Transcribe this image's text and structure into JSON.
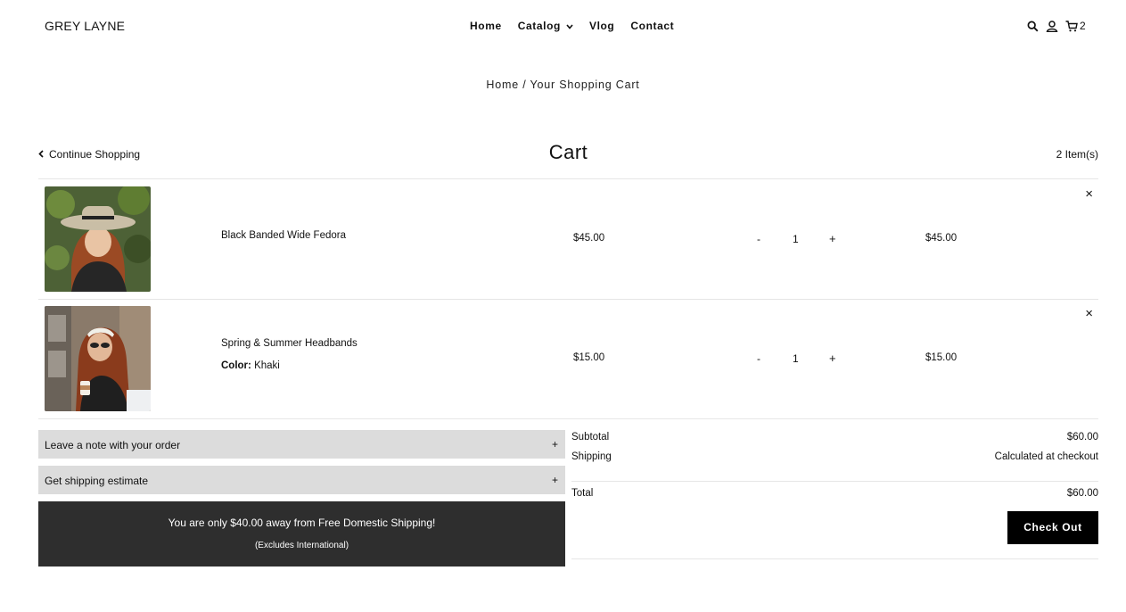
{
  "header": {
    "logo": "GREY LAYNE",
    "nav": [
      "Home",
      "Catalog",
      "Vlog",
      "Contact"
    ],
    "cart_count": "2"
  },
  "breadcrumb": "Home / Your Shopping Cart",
  "cart": {
    "continue_label": "Continue Shopping",
    "title": "Cart",
    "item_count": "2 Item(s)",
    "items": [
      {
        "name": "Black Banded Wide Fedora",
        "variant_label": "",
        "variant_value": "",
        "price": "$45.00",
        "qty": "1",
        "total": "$45.00"
      },
      {
        "name": "Spring & Summer Headbands",
        "variant_label": "Color:",
        "variant_value": "Khaki",
        "price": "$15.00",
        "qty": "1",
        "total": "$15.00"
      }
    ],
    "qty_minus": "-",
    "qty_plus": "+",
    "remove_symbol": "×"
  },
  "accordions": {
    "note_label": "Leave a note with your order",
    "shipping_label": "Get shipping estimate",
    "plus": "+"
  },
  "shipping_banner": {
    "line1": "You are only $40.00 away from Free Domestic Shipping!",
    "line2": "(Excludes International)"
  },
  "summary": {
    "subtotal_label": "Subtotal",
    "subtotal_value": "$60.00",
    "shipping_label": "Shipping",
    "shipping_value": "Calculated at checkout",
    "total_label": "Total",
    "total_value": "$60.00",
    "checkout_label": "Check Out"
  },
  "colors": {
    "banner_bg": "#2e2e2e",
    "accordion_bg": "#dcdcdc",
    "button_bg": "#000000"
  }
}
